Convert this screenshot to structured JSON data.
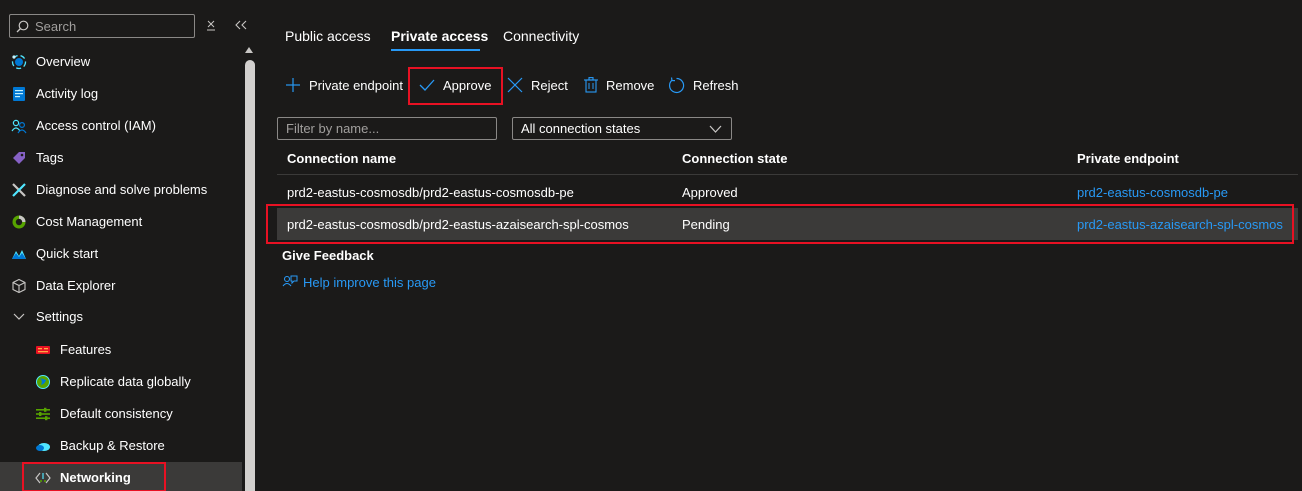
{
  "sidebar": {
    "search_placeholder": "Search",
    "items": [
      {
        "label": "Overview"
      },
      {
        "label": "Activity log"
      },
      {
        "label": "Access control (IAM)"
      },
      {
        "label": "Tags"
      },
      {
        "label": "Diagnose and solve problems"
      },
      {
        "label": "Cost Management"
      },
      {
        "label": "Quick start"
      },
      {
        "label": "Data Explorer"
      },
      {
        "label": "Settings"
      },
      {
        "label": "Features"
      },
      {
        "label": "Replicate data globally"
      },
      {
        "label": "Default consistency"
      },
      {
        "label": "Backup & Restore"
      },
      {
        "label": "Networking"
      }
    ]
  },
  "tabs": [
    {
      "label": "Public access"
    },
    {
      "label": "Private access"
    },
    {
      "label": "Connectivity"
    }
  ],
  "toolbar": {
    "private_endpoint": "Private endpoint",
    "approve": "Approve",
    "reject": "Reject",
    "remove": "Remove",
    "refresh": "Refresh"
  },
  "filter": {
    "placeholder": "Filter by name...",
    "state_value": "All connection states"
  },
  "table": {
    "headers": [
      "Connection name",
      "Connection state",
      "Private endpoint"
    ],
    "rows": [
      [
        "prd2-eastus-cosmosdb/prd2-eastus-cosmosdb-pe",
        "Approved",
        "prd2-eastus-cosmosdb-pe"
      ],
      [
        "prd2-eastus-cosmosdb/prd2-eastus-azaisearch-spl-cosmos",
        "Pending",
        "prd2-eastus-azaisearch-spl-cosmos"
      ]
    ]
  },
  "feedback": {
    "title": "Give Feedback",
    "link": "Help improve this page"
  },
  "colors": {
    "accent": "#2899f5",
    "highlight": "#e81123",
    "background": "#1b1a19"
  }
}
